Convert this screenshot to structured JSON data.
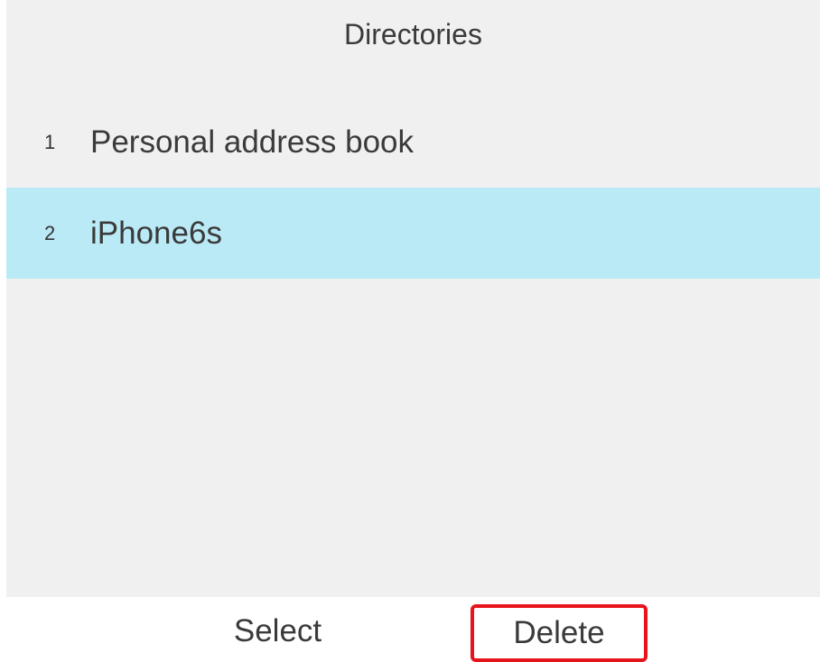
{
  "header": {
    "title": "Directories"
  },
  "directories": [
    {
      "number": "1",
      "label": "Personal address book",
      "selected": false
    },
    {
      "number": "2",
      "label": "iPhone6s",
      "selected": true
    }
  ],
  "softkeys": {
    "select_label": "Select",
    "delete_label": "Delete"
  },
  "colors": {
    "screen_bg": "#f0f0f0",
    "selected_row": "#baeaf6",
    "highlight_border": "#e8141b"
  }
}
